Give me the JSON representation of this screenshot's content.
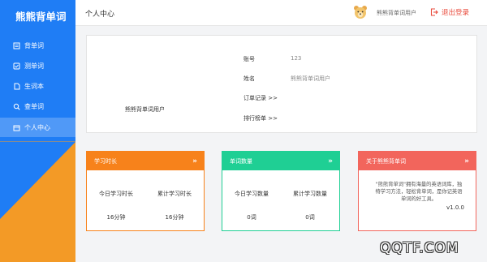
{
  "app": {
    "title": "熊熊背单词"
  },
  "sidebar": {
    "items": [
      {
        "label": "背单词",
        "icon": "book-icon"
      },
      {
        "label": "测单词",
        "icon": "quiz-icon"
      },
      {
        "label": "生词本",
        "icon": "notebook-icon"
      },
      {
        "label": "查单词",
        "icon": "search-icon"
      },
      {
        "label": "个人中心",
        "icon": "calendar-icon"
      }
    ]
  },
  "header": {
    "page_title": "个人中心",
    "username": "熊熊背单词用户",
    "logout_label": "退出登录"
  },
  "profile": {
    "display_name": "熊熊背单词用户",
    "account_label": "账号",
    "account_value": "123",
    "name_label": "姓名",
    "name_value": "熊熊背单词用户",
    "orders_link": "订单记录  >>",
    "ranking_link": "排行榜单  >>"
  },
  "cards": {
    "study": {
      "title": "学习时长",
      "today_label": "今日学习时长",
      "total_label": "累计学习时长",
      "today_value": "16分钟",
      "total_value": "16分钟",
      "color": "#f7821b"
    },
    "words": {
      "title": "单词数量",
      "today_label": "今日学习数量",
      "total_label": "累计学习数量",
      "today_value": "0词",
      "total_value": "0词",
      "color": "#1fcf94"
    },
    "about": {
      "title": "关于熊熊背单词",
      "text": "\"熊熊背单词\"拥有海量的英语词库，独特学习方法，轻松背单词，是你记英语单词的好工具。",
      "version": "v1.0.0",
      "color": "#f2655c"
    }
  },
  "chevron": "»",
  "watermark": "QQTF.COM",
  "colors": {
    "sidebar_blue": "#1f7df5",
    "sidebar_orange": "#f39a26",
    "logout_red": "#e94b3c"
  }
}
